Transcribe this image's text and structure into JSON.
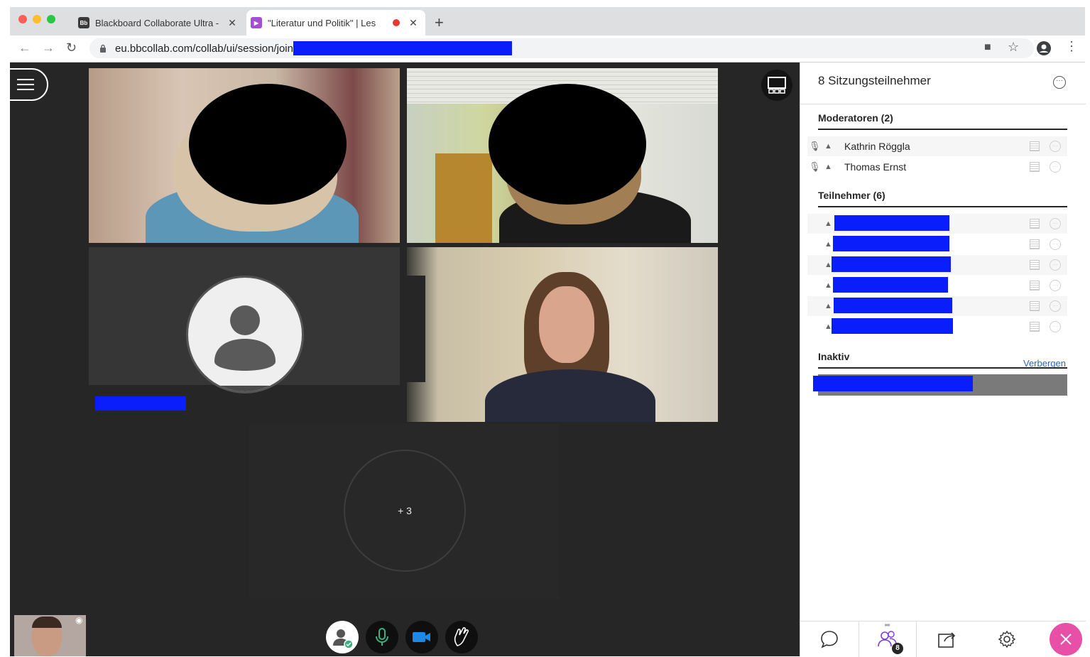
{
  "browser": {
    "tabs": [
      {
        "favicon": "Bb",
        "title": "Blackboard Collaborate Ultra -",
        "close": "✕"
      },
      {
        "favicon": "▶",
        "title": "\"Literatur und Politik\" | Les",
        "close": "✕"
      }
    ],
    "new_tab": "+",
    "url": "eu.bbcollab.com/collab/ui/session/join"
  },
  "video": {
    "overflow_label": "+ 3"
  },
  "panel": {
    "title": "8 Sitzungsteilnehmer",
    "moderators_title": "Moderatoren (2)",
    "moderators": [
      {
        "name": "Kathrin Röggla"
      },
      {
        "name": "Thomas Ernst"
      }
    ],
    "participants_title": "Teilnehmer (6)",
    "inactive_title": "Inaktiv",
    "hide_link": "Verbergen",
    "participants_badge": "8"
  },
  "colors": {
    "accent_close": "#e84fa6",
    "mic_active": "#36b37e",
    "redaction": "#0a1efc"
  }
}
